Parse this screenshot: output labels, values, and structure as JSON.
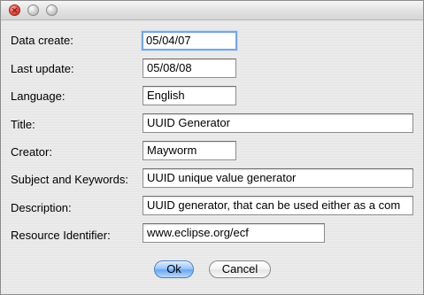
{
  "fields": {
    "data_create": {
      "label": "Data create:",
      "value": "05/04/07"
    },
    "last_update": {
      "label": "Last update:",
      "value": "05/08/08"
    },
    "language": {
      "label": "Language:",
      "value": "English"
    },
    "title": {
      "label": "Title:",
      "value": "UUID Generator"
    },
    "creator": {
      "label": "Creator:",
      "value": "Mayworm"
    },
    "subject_keywords": {
      "label": "Subject and Keywords:",
      "value": "UUID unique value generator"
    },
    "description": {
      "label": "Description:",
      "value": "UUID generator, that can be used either as a com"
    },
    "resource_identifier": {
      "label": "Resource Identifier:",
      "value": "www.eclipse.org/ecf"
    }
  },
  "buttons": {
    "ok": "Ok",
    "cancel": "Cancel"
  },
  "colors": {
    "focus_ring": "#79a6df",
    "default_button": "#6ba6ef",
    "window_background": "#e8e8e8"
  }
}
